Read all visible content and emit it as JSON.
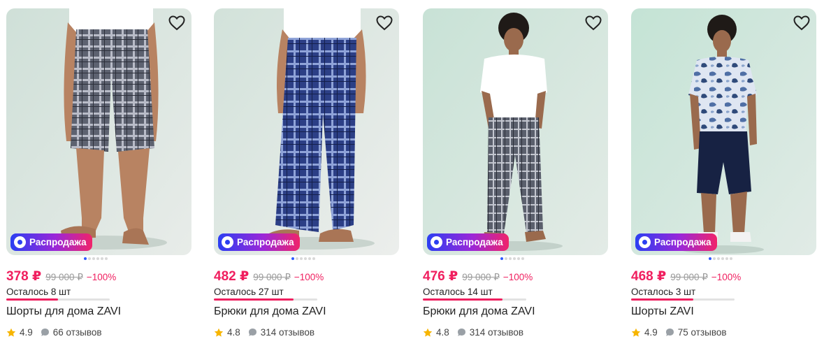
{
  "products": [
    {
      "price": "378 ₽",
      "old_price": "99 000 ₽",
      "discount": "−100%",
      "badge": "Распродажа",
      "stock_text": "Осталось 8 шт",
      "stock_level": 0.5,
      "name": "Шорты для дома ZAVI",
      "rating": "4.9",
      "reviews": "66 отзывов",
      "image": "shorts-gray-plaid"
    },
    {
      "price": "482 ₽",
      "old_price": "99 000 ₽",
      "discount": "−100%",
      "badge": "Распродажа",
      "stock_text": "Осталось 27 шт",
      "stock_level": 0.77,
      "name": "Брюки для дома ZAVI",
      "rating": "4.8",
      "reviews": "314 отзывов",
      "image": "pants-blue-plaid"
    },
    {
      "price": "476 ₽",
      "old_price": "99 000 ₽",
      "discount": "−100%",
      "badge": "Распродажа",
      "stock_text": "Осталось 14 шт",
      "stock_level": 0.77,
      "name": "Брюки для дома ZAVI",
      "rating": "4.8",
      "reviews": "314 отзывов",
      "image": "pants-gray-plaid-model"
    },
    {
      "price": "468 ₽",
      "old_price": "99 000 ₽",
      "discount": "−100%",
      "badge": "Распродажа",
      "stock_text": "Осталось 3 шт",
      "stock_level": 0.6,
      "name": "Шорты ZAVI",
      "rating": "4.9",
      "reviews": "75 отзывов",
      "image": "shorts-navy-model"
    }
  ],
  "colors": {
    "accent": "#f01f5f",
    "active_dot": "#2f5bff",
    "star": "#f7b500"
  },
  "icons": {
    "favorite": "heart-outline-icon",
    "rating": "star-icon",
    "reviews": "chat-bubble-icon",
    "badge": "sale-icon"
  }
}
